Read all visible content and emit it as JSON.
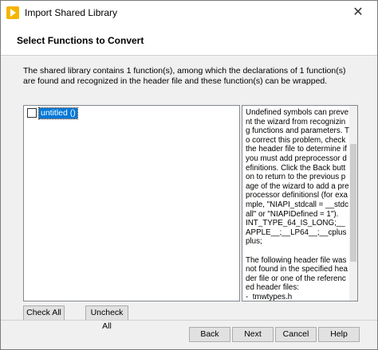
{
  "window": {
    "title": "Import Shared Library",
    "close_glyph": "✕"
  },
  "header": {
    "title": "Select Functions to Convert"
  },
  "description": "The shared library contains 1 function(s), among which the declarations of 1 function(s) are found and recognized in the header file and these function(s) can be wrapped.",
  "functions": [
    {
      "label": "untitled ()",
      "checked": false
    }
  ],
  "info_panel": {
    "text": "Undefined symbols can prevent the wizard from recognizing functions and parameters. To correct this problem, check the header file to determine if you must add preprocessor definitions. Click the Back button to return to the previous page of the wizard to add a preprocessor definitionsl (for example, \"NIAPI_stdcall = __stdcall\" or \"NIAPIDefined = 1\").\nINT_TYPE_64_IS_LONG;__APPLE__;__LP64__;__cplusplus;\n\nThe following header file was not found in the specified header file or one of the referenced header files:\n-  tmwtypes.h\n-  stddef.h\n-  stdlib.h\n\nTo fix, click the Back button to go to the previous page and add the header file path to the Include Paths list."
  },
  "buttons": {
    "check_all": "Check All",
    "uncheck_all": "Uncheck All",
    "back": "Back",
    "next": "Next",
    "cancel": "Cancel",
    "help": "Help"
  },
  "colors": {
    "selection": "#0078d7",
    "app_icon": "#f5b400"
  },
  "icons": {
    "app": "labview-import-icon",
    "close": "close-icon"
  }
}
